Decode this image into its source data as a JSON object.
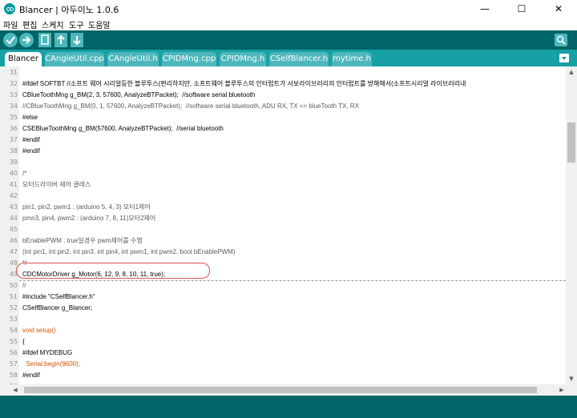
{
  "window": {
    "title": "Blancer | 아두이노 1.0.6",
    "minimize": "—",
    "maximize": "☐",
    "close": "✕"
  },
  "menu": [
    "파일",
    "편집",
    "스케치",
    "도구",
    "도움말"
  ],
  "toolbar": {
    "buttons": [
      "verify-icon",
      "upload-icon",
      "new-icon",
      "open-icon",
      "save-icon",
      "serial-monitor-icon"
    ],
    "colors": {
      "bar": "#006468",
      "button": "#4db7bb"
    }
  },
  "tabs": [
    {
      "label": "Blancer",
      "active": true
    },
    {
      "label": "CAngleUtil.cpp"
    },
    {
      "label": "CAngleUtil.h"
    },
    {
      "label": "CPIDMng.cpp"
    },
    {
      "label": "CPIDMng.h"
    },
    {
      "label": "CSelfBlancer.h"
    },
    {
      "label": "mytime.h"
    }
  ],
  "code": [
    {
      "n": "31",
      "t": ""
    },
    {
      "n": "32",
      "t": "#ifdef SOFTBT //소프트 웨어 시리얼등한 블루투스(편리하지만, 소프트웨어 블루투스의 인터럽트가 서보라이브러리의 인터럽트를 방해해서(소프트시리얼 라이브러리내"
    },
    {
      "n": "33",
      "t": "CBlueToothMng g_BM(2, 3, 57600, AnalyzeBTPacket);  //software serial bluetooth"
    },
    {
      "n": "34",
      "t": "//CBlueToothMng g_BM(0, 1, 57600, AnalyzeBTPacket);  //software serial bluetooth, ADU RX, TX => blueTooth TX, RX"
    },
    {
      "n": "35",
      "t": "#else"
    },
    {
      "n": "36",
      "t": "CSEBlueToothMng g_BM(57600, AnalyzeBTPacket);  //serial bluetooth"
    },
    {
      "n": "37",
      "t": "#endif"
    },
    {
      "n": "38",
      "t": "#endif"
    },
    {
      "n": "39",
      "t": ""
    },
    {
      "n": "40",
      "t": "/*"
    },
    {
      "n": "41",
      "t": "모터드라이버 제어 클래스"
    },
    {
      "n": "42",
      "t": ""
    },
    {
      "n": "43",
      "t": "pin1, pin2, pwm1 : (arduino 5, 4, 3) 모터1제어"
    },
    {
      "n": "44",
      "t": "pmn3, pin4, pwm2 : (arduino 7, 8, 11)모터2제어"
    },
    {
      "n": "45",
      "t": ""
    },
    {
      "n": "46",
      "t": "bEnablePWM : true일경우 pwm제어를 수행"
    },
    {
      "n": "47",
      "t": "(int pin1, int pin2, int pin3, int pin4, int pwm1, int pwm2, bool bEnablePWM)"
    },
    {
      "n": "48",
      "t": "*/"
    },
    {
      "n": "49",
      "t": "CDCMotorDriver g_Motor(6, 12, 9, 8, 10, 11, true);"
    },
    {
      "n": "50",
      "t": "//"
    },
    {
      "n": "51",
      "t": "#include \"CSelfBlancer.h\""
    },
    {
      "n": "52",
      "t": "CSelfBlancer g_Blancer;"
    },
    {
      "n": "53",
      "t": ""
    },
    {
      "n": "54",
      "t": "void setup()"
    },
    {
      "n": "55",
      "t": "{"
    },
    {
      "n": "56",
      "t": "#ifdef MYDEBUG"
    },
    {
      "n": "57",
      "t": "  Serial.begin(9600);"
    },
    {
      "n": "58",
      "t": "#endif"
    },
    {
      "n": "59",
      "t": ""
    }
  ],
  "colors": {
    "tabbar": "#17a1a5",
    "highlight": "#d9534f",
    "keyword": "#d35400",
    "comment": "#5a5a5a"
  }
}
